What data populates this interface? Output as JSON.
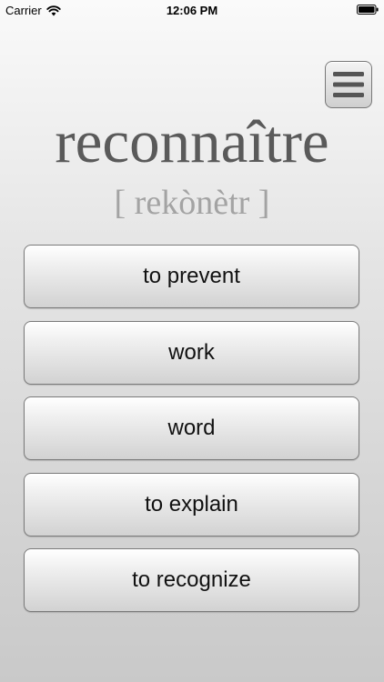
{
  "status_bar": {
    "carrier": "Carrier",
    "time": "12:06 PM",
    "wifi_icon": "wifi-icon",
    "battery_icon": "battery-icon"
  },
  "menu": {
    "icon": "hamburger-menu-icon"
  },
  "quiz": {
    "word": "reconnaître",
    "pronunciation": "[ rekònètr ]",
    "answers": [
      "to prevent",
      "work",
      "word",
      "to explain",
      "to recognize"
    ]
  },
  "colors": {
    "word": "#5a5a5a",
    "pronunciation": "#a3a3a3",
    "button_border": "#7a7a7a"
  }
}
